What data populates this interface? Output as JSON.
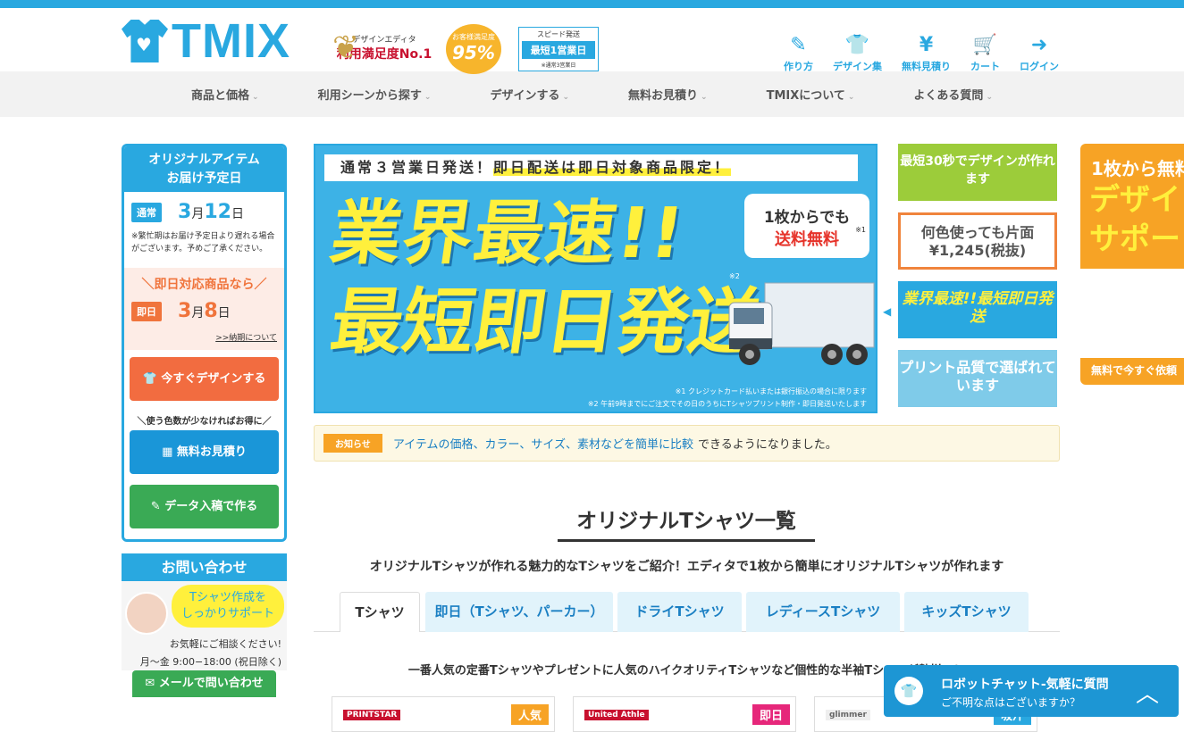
{
  "brand": {
    "name": "TMIX"
  },
  "badges": {
    "satisfaction_label": "デザインエディタ",
    "satisfaction_value": "利用満足度No.1",
    "customer_label": "お客様満足度",
    "customer_value": "95%",
    "speed_label": "スピード発送",
    "speed_value": "最短1営業日",
    "speed_note": "※通常3営業日"
  },
  "header_nav": [
    {
      "label": "作り方",
      "icon": "pen-icon",
      "glyph": "✎"
    },
    {
      "label": "デザイン集",
      "icon": "shirt-edit-icon",
      "glyph": "👕"
    },
    {
      "label": "無料見積り",
      "icon": "yen-icon",
      "glyph": "¥"
    },
    {
      "label": "カート",
      "icon": "cart-icon",
      "glyph": "🛒"
    },
    {
      "label": "ログイン",
      "icon": "login-icon",
      "glyph": "➜"
    }
  ],
  "global_nav": [
    "商品と価格",
    "利用シーンから探す",
    "デザインする",
    "無料お見積り",
    "TMIXについて",
    "よくある質問"
  ],
  "sidebar": {
    "delivery_title_1": "オリジナルアイテム",
    "delivery_title_2": "お届け予定日",
    "normal_tag": "通常",
    "normal_month": "3",
    "normal_day": "12",
    "month_unit": "月",
    "day_unit": "日",
    "busy_note": "※繁忙期はお届け予定日より遅れる場合がございます。予めご了承ください。",
    "sokujitsu_title": "＼即日対応商品なら／",
    "sokujitsu_tag": "即日",
    "sokujitsu_month": "3",
    "sokujitsu_day": "8",
    "delivery_link": ">>納期について",
    "design_btn": "今すぐデザインする",
    "tip": "＼使う色数が少なければお得に／",
    "estimate_btn": "無料お見積り",
    "data_btn": "データ入稿で作る",
    "contact_title": "お問い合わせ",
    "contact_bubble_1": "Tシャツ作成を",
    "contact_bubble_2": "しっかりサポート",
    "contact_text": "お気軽にご相談ください!",
    "contact_hours": "月〜金 9:00−18:00 (祝日除く)",
    "mail_btn": "メールで問い合わせ"
  },
  "banner": {
    "strip_a": "通常３営業日発送！",
    "strip_b": "即日配送は即日対象商品限定！",
    "big_1": "業界最速!!",
    "big_2": "最短即日発送",
    "bubble_a": "1枚からでも",
    "bubble_b": "送料無料",
    "bubble_note": "※1",
    "note2_mark": "※2",
    "footnote_1": "※1 クレジットカード払いまたは銀行振込の場合に限ります",
    "footnote_2": "※2 午前9時までにご注文でその日のうちにTシャツプリント制作・即日発送いたします"
  },
  "thumbs": [
    "最短30秒でデザインが作れます",
    "何色使っても片面¥1,245(税抜)",
    "業界最速!!最短即日発送",
    "プリント品質で選ばれています"
  ],
  "right_ad": {
    "line1": "1枚から無料",
    "line2": "デザイ",
    "line3": "サポー",
    "foot": "無料で今すぐ依頼"
  },
  "notice": {
    "tag": "お知らせ",
    "link": "アイテムの価格、カラー、サイズ、素材などを簡単に比較",
    "text": "できるようになりました。"
  },
  "section": {
    "title": "オリジナルTシャツ一覧",
    "lead": "オリジナルTシャツが作れる魅力的なTシャツをご紹介！エディタで1枚から簡単にオリジナルTシャツが作れます",
    "sub": "一番人気の定番Tシャツやプレゼントに人気のハイクオリティTシャツなど個性的な半袖Tシャツが勢揃い！"
  },
  "tabs": [
    "Tシャツ",
    "即日（Tシャツ、パーカー）",
    "ドライTシャツ",
    "レディースTシャツ",
    "キッズTシャツ"
  ],
  "cards": [
    {
      "brand": "PRINTSTAR",
      "ribbon": "人気",
      "color": "#f7a325"
    },
    {
      "brand": "United Athle",
      "ribbon": "即日",
      "color": "#e6277a"
    },
    {
      "brand": "glimmer",
      "ribbon": "吸汗",
      "color": "#29a8e0"
    }
  ],
  "chat": {
    "title": "ロボットチャット-気軽に質問",
    "sub": "ご不明な点はございますか？"
  }
}
